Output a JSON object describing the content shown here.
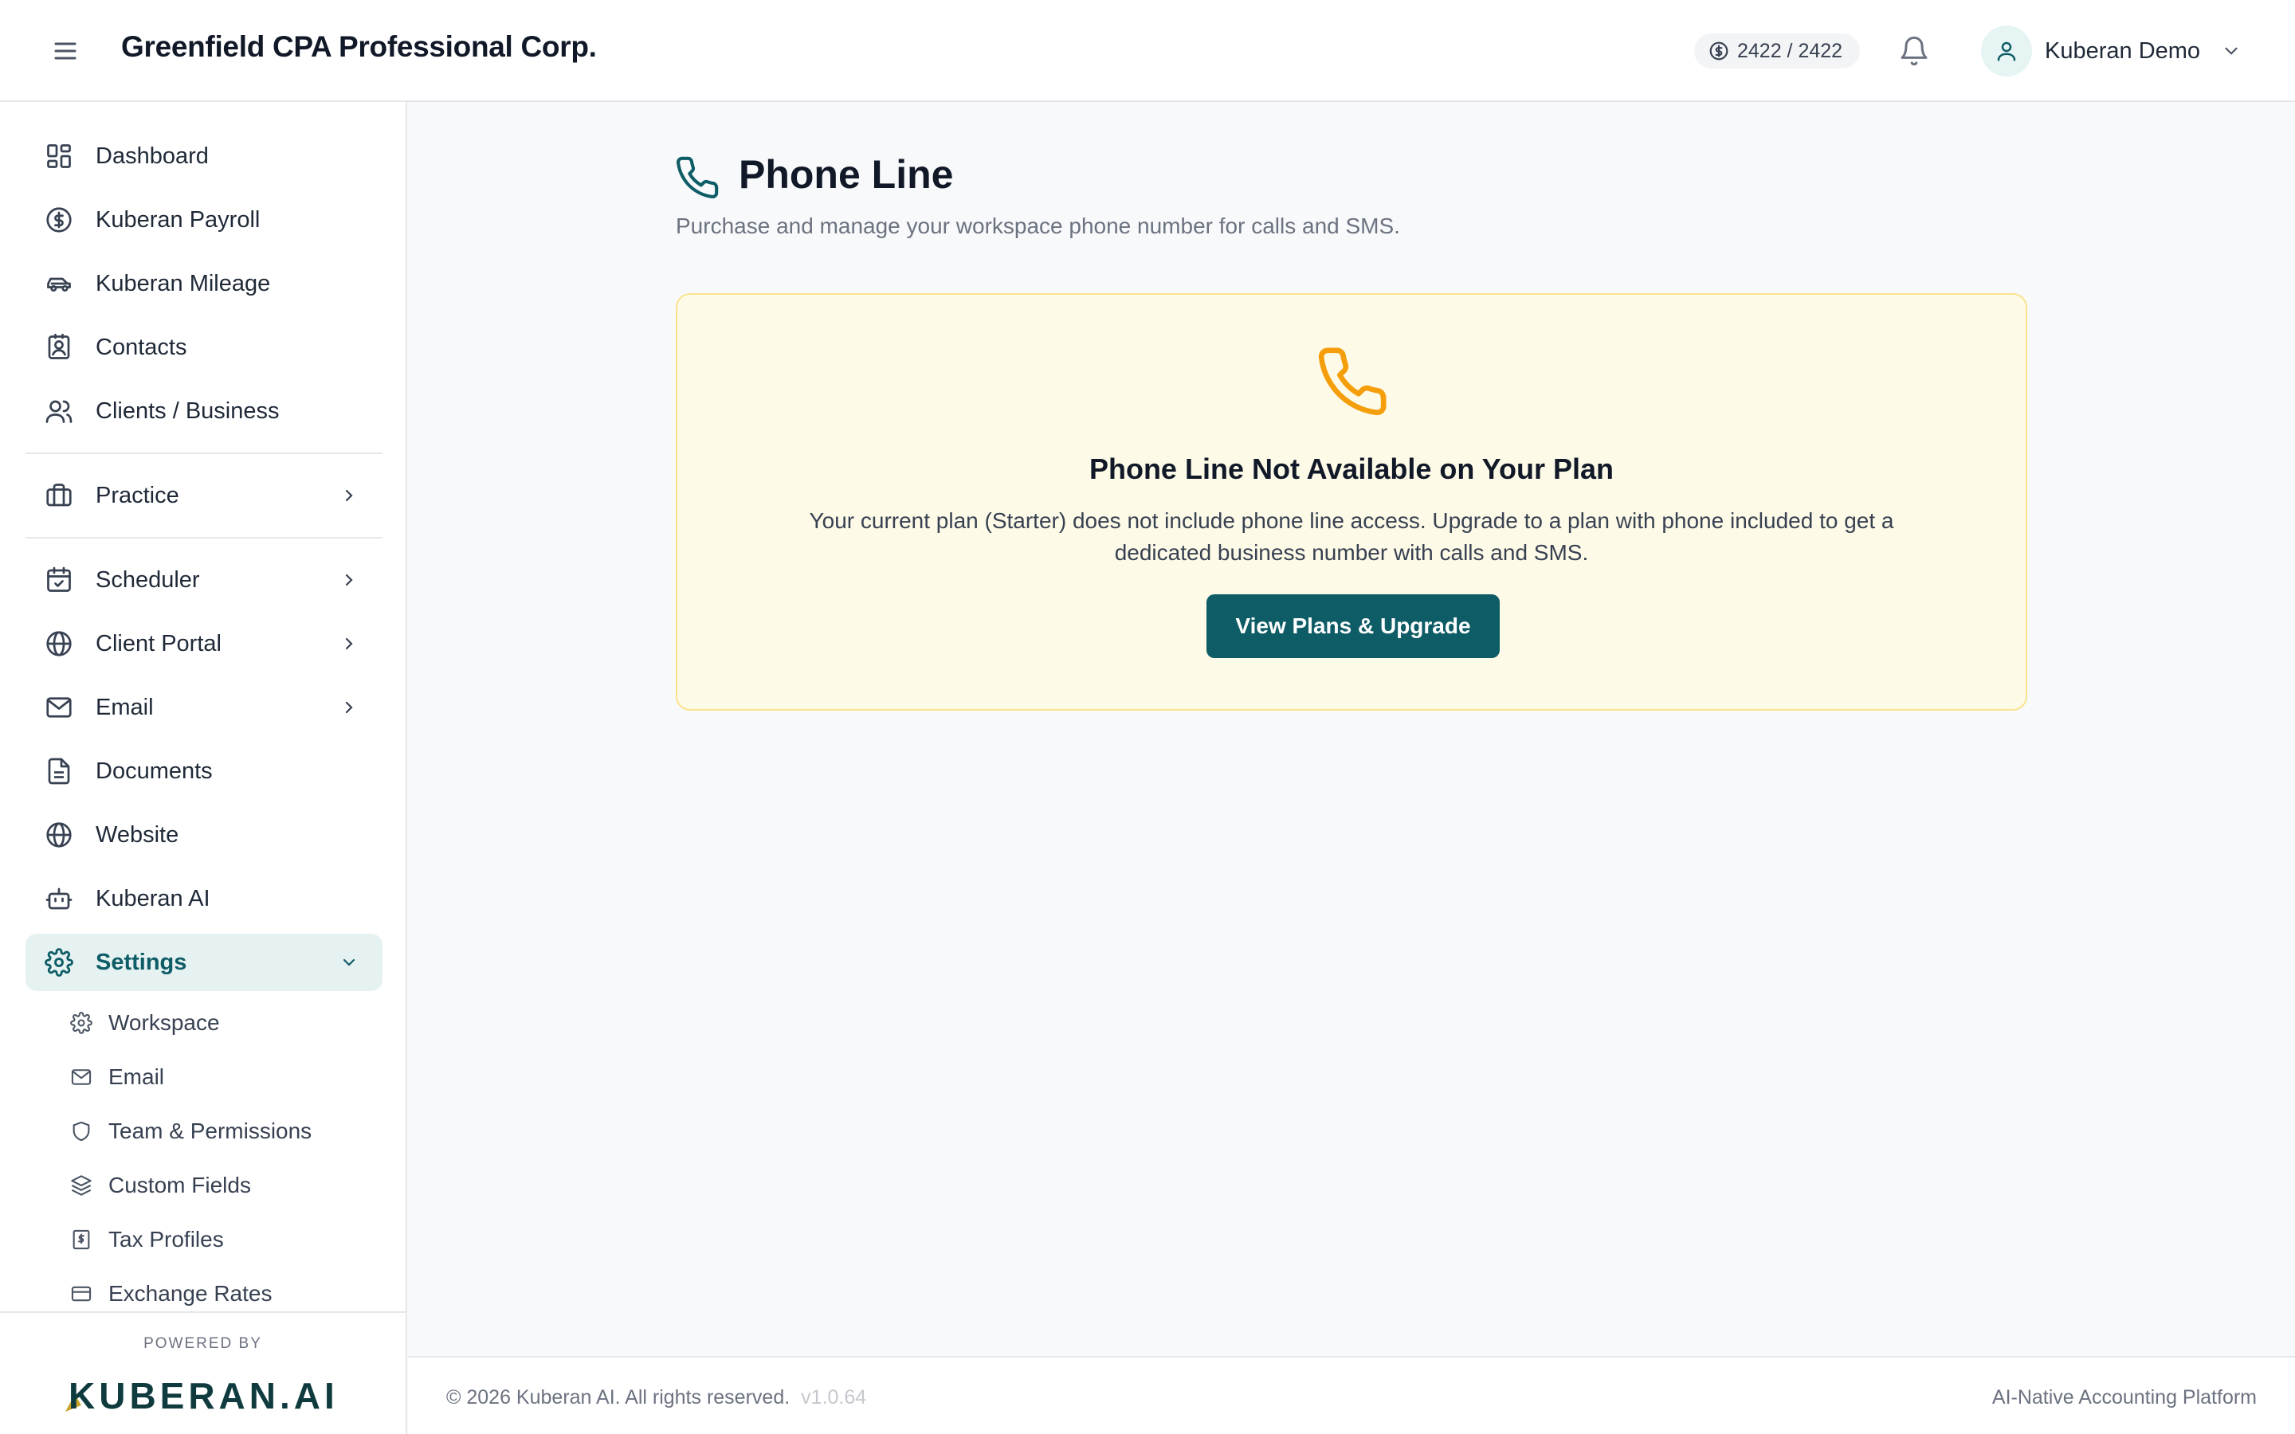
{
  "header": {
    "org_name": "Greenfield CPA Professional Corp.",
    "credits": "2422 / 2422",
    "user_name": "Kuberan Demo"
  },
  "sidebar": {
    "items": [
      {
        "label": "Dashboard",
        "icon": "dashboard-icon"
      },
      {
        "label": "Kuberan Payroll",
        "icon": "dollar-circle-icon"
      },
      {
        "label": "Kuberan Mileage",
        "icon": "car-icon"
      },
      {
        "label": "Contacts",
        "icon": "contact-card-icon"
      },
      {
        "label": "Clients / Business",
        "icon": "users-icon"
      },
      {
        "label": "Practice",
        "icon": "briefcase-icon",
        "expandable": true
      },
      {
        "label": "Scheduler",
        "icon": "calendar-check-icon",
        "expandable": true
      },
      {
        "label": "Client Portal",
        "icon": "globe-icon",
        "expandable": true
      },
      {
        "label": "Email",
        "icon": "mail-icon",
        "expandable": true
      },
      {
        "label": "Documents",
        "icon": "document-icon"
      },
      {
        "label": "Website",
        "icon": "globe-icon"
      },
      {
        "label": "Kuberan AI",
        "icon": "bot-icon"
      },
      {
        "label": "Settings",
        "icon": "gear-icon",
        "expanded": true,
        "active": true
      }
    ],
    "settings_sub": [
      {
        "label": "Workspace",
        "icon": "gear-icon"
      },
      {
        "label": "Email",
        "icon": "mail-icon"
      },
      {
        "label": "Team & Permissions",
        "icon": "shield-icon"
      },
      {
        "label": "Custom Fields",
        "icon": "layers-icon"
      },
      {
        "label": "Tax Profiles",
        "icon": "receipt-icon"
      },
      {
        "label": "Exchange Rates",
        "icon": "credit-card-icon"
      }
    ],
    "powered_by": "POWERED BY",
    "brand": "KUBERAN.AI"
  },
  "main": {
    "title": "Phone Line",
    "subtitle": "Purchase and manage your workspace phone number for calls and SMS.",
    "notice": {
      "title": "Phone Line Not Available on Your Plan",
      "body": "Your current plan (Starter) does not include phone line access. Upgrade to a plan with phone included to get a dedicated business number with calls and SMS.",
      "button_label": "View Plans & Upgrade"
    }
  },
  "footer": {
    "copyright": "© 2026 Kuberan AI. All rights reserved.",
    "version": "v1.0.64",
    "tagline": "AI-Native Accounting Platform"
  },
  "colors": {
    "brand_teal": "#0e5c66",
    "notice_bg": "#fefae8",
    "notice_border": "#fbe38c",
    "phone_orange": "#f59e0b",
    "active_bg": "#e6f2f2"
  }
}
